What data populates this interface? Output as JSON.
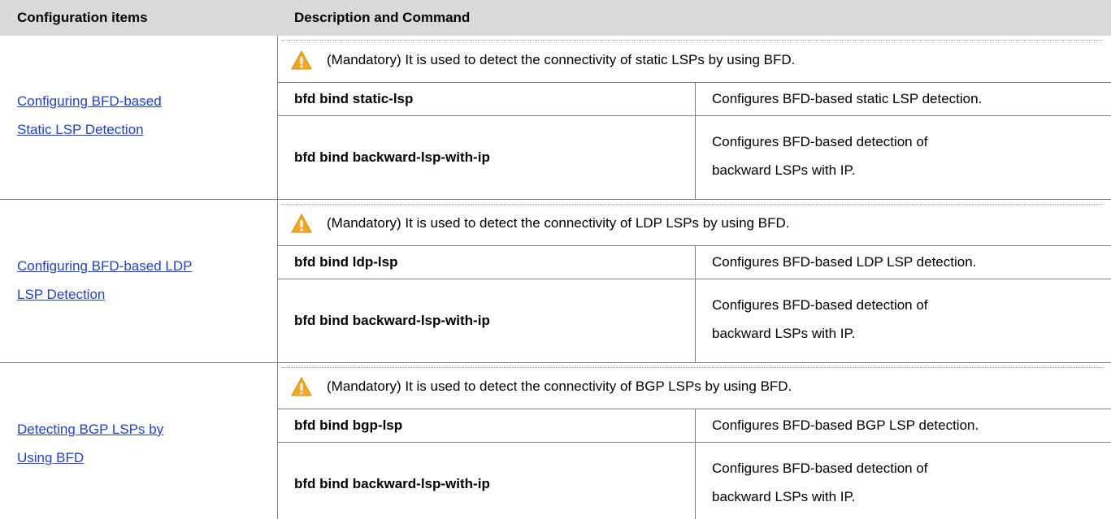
{
  "header": {
    "col1": "Configuration items",
    "col2": "Description and Command"
  },
  "sections": [
    {
      "link_line1": "Configuring BFD-based ",
      "link_line2": "Static LSP Detection",
      "note": "(Mandatory) It is used to detect the connectivity of static LSPs by using BFD.",
      "rows": [
        {
          "command": "bfd bind static-lsp",
          "description": "Configures BFD-based static LSP detection."
        },
        {
          "command": "bfd bind backward-lsp-with-ip",
          "description_line1": "Configures BFD-based detection of",
          "description_line2": "backward LSPs with IP."
        }
      ]
    },
    {
      "link_line1": "Configuring BFD-based LDP ",
      "link_line2": "LSP Detection",
      "note": "(Mandatory) It is used to detect the connectivity of LDP LSPs by using BFD.",
      "rows": [
        {
          "command": "bfd bind ldp-lsp",
          "description": "Configures BFD-based LDP LSP detection."
        },
        {
          "command": "bfd bind backward-lsp-with-ip",
          "description_line1": "Configures BFD-based detection of",
          "description_line2": "backward LSPs with IP."
        }
      ]
    },
    {
      "link_line1": "Detecting BGP LSPs by ",
      "link_line2": "Using BFD",
      "note": "(Mandatory) It is used to detect the connectivity of BGP LSPs by using BFD.",
      "rows": [
        {
          "command": "bfd bind bgp-lsp",
          "description": "Configures BFD-based BGP LSP detection."
        },
        {
          "command": "bfd bind backward-lsp-with-ip",
          "description_line1": "Configures BFD-based detection of",
          "description_line2": "backward LSPs with IP."
        }
      ]
    }
  ],
  "icons": {
    "warning": "warning-triangle-icon"
  },
  "colors": {
    "header_bg": "#d9d9d9",
    "link": "#1f3fd8",
    "warning_fill": "#f5a623"
  }
}
